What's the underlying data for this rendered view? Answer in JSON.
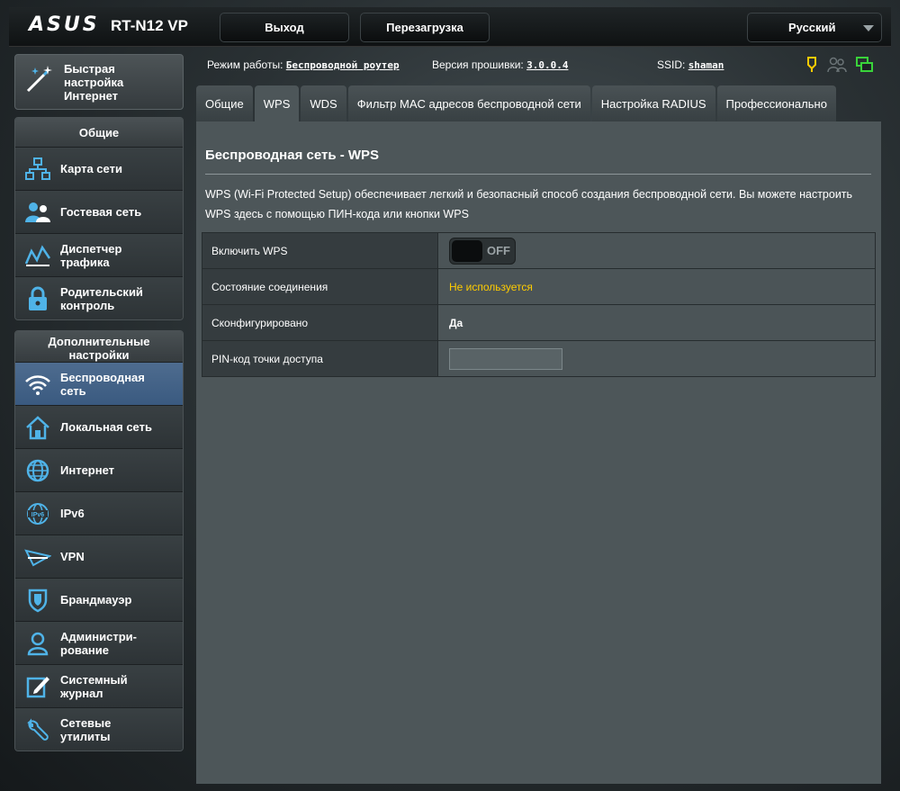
{
  "header": {
    "logo": "ASUS",
    "model": "RT-N12 VP",
    "logout_label": "Выход",
    "reboot_label": "Перезагрузка",
    "language": "Русский"
  },
  "status": {
    "mode_label": "Режим работы:",
    "mode_value": "Беспроводной роутер",
    "firmware_label": "Версия прошивки:",
    "firmware_value": "3.0.0.4",
    "ssid_label": "SSID:",
    "ssid_value": "shaman"
  },
  "sidebar": {
    "quick_setup": "Быстрая\nнастройка\nИнтернет",
    "general_title": "Общие",
    "general_items": [
      {
        "label": "Карта сети",
        "icon": "network-map-icon"
      },
      {
        "label": "Гостевая сеть",
        "icon": "guest-network-icon"
      },
      {
        "label": "Диспетчер\nтрафика",
        "icon": "traffic-manager-icon"
      },
      {
        "label": "Родительский\nконтроль",
        "icon": "parental-lock-icon"
      }
    ],
    "advanced_title": "Дополнительные\nнастройки",
    "advanced_items": [
      {
        "label": "Беспроводная\nсеть",
        "icon": "wifi-icon",
        "active": true
      },
      {
        "label": "Локальная сеть",
        "icon": "home-icon"
      },
      {
        "label": "Интернет",
        "icon": "globe-icon"
      },
      {
        "label": "IPv6",
        "icon": "ipv6-icon"
      },
      {
        "label": "VPN",
        "icon": "vpn-icon"
      },
      {
        "label": "Брандмауэр",
        "icon": "shield-icon"
      },
      {
        "label": "Администри-\nрование",
        "icon": "admin-user-icon"
      },
      {
        "label": "Системный\nжурнал",
        "icon": "log-edit-icon"
      },
      {
        "label": "Сетевые\nутилиты",
        "icon": "wrench-icon"
      }
    ]
  },
  "tabs": [
    {
      "label": "Общие"
    },
    {
      "label": "WPS",
      "active": true
    },
    {
      "label": "WDS"
    },
    {
      "label": "Фильтр MAC адресов беспроводной сети"
    },
    {
      "label": "Настройка RADIUS"
    },
    {
      "label": "Профессионально"
    }
  ],
  "main": {
    "title": "Беспроводная сеть - WPS",
    "description": "WPS (Wi-Fi Protected Setup) обеспечивает легкий и безопасный способ создания беспроводной сети. Вы можете настроить WPS здесь с помощью ПИН-кода или кнопки WPS",
    "rows": {
      "enable_label": "Включить WPS",
      "enable_state": "OFF",
      "conn_label": "Состояние соединения",
      "conn_value": "Не используется",
      "configured_label": "Сконфигурировано",
      "configured_value": "Да",
      "pin_label": "PIN-код точки доступа",
      "pin_value": ""
    }
  },
  "colors": {
    "accent_yellow": "#ffcc00",
    "active_blue": "#3a5a80",
    "icon_blue": "#4fb3e8",
    "status_green": "#39d33a"
  }
}
